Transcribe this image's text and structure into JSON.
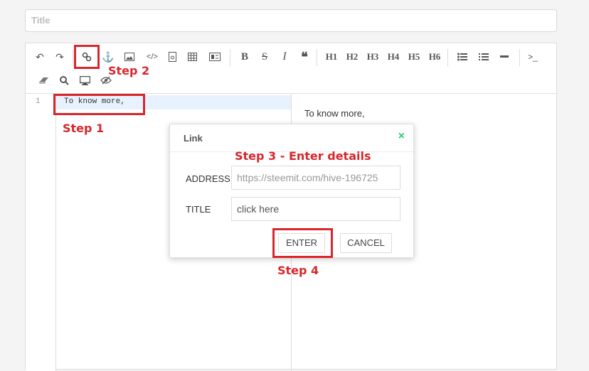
{
  "title_placeholder": "Title",
  "toolbar": {
    "headings": [
      "H1",
      "H2",
      "H3",
      "H4",
      "H5",
      "H6"
    ]
  },
  "editor": {
    "line_number": "1",
    "code_text": "To know more,"
  },
  "preview": {
    "text": "To know more,"
  },
  "dialog": {
    "title": "Link",
    "close_icon": "×",
    "address_label": "ADDRESS",
    "address_value": "https://steemit.com/hive-196725",
    "title_label": "TITLE",
    "title_placeholder": "click here",
    "enter_label": "ENTER",
    "cancel_label": "CANCEL"
  },
  "annotations": {
    "step1": "Step 1",
    "step2": "Step 2",
    "step3": "Step 3 - Enter details",
    "step4": "Step 4",
    "color": "#d8262c"
  }
}
